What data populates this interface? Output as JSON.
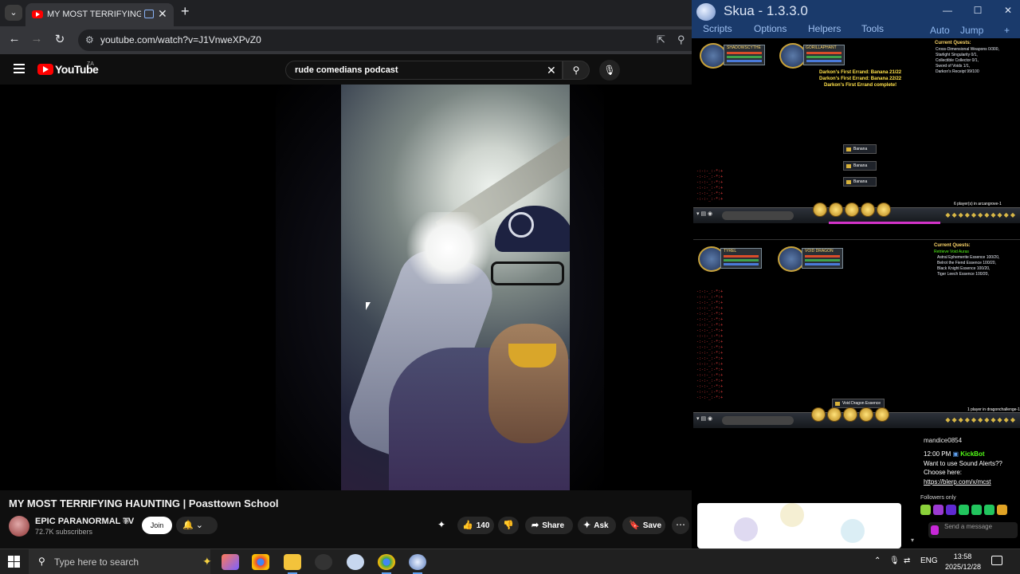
{
  "browser": {
    "tab_menu": "⌄",
    "tab_title": "MY MOST TERRIFYING HAU",
    "tab_close": "✕",
    "new_tab": "+",
    "url": "youtube.com/watch?v=J1VnweXPvZ0"
  },
  "youtube": {
    "logo_text": "YouTube",
    "country": "ZA",
    "search_value": "rude comedians podcast",
    "video_title": "MY MOST TERRIFYING HAUNTING | Poasttown School",
    "channel_name": "EPIC PARANORMAL TV",
    "subscribers": "72.7K subscribers",
    "join_label": "Join",
    "like_count": "140",
    "share_label": "Share",
    "ask_label": "Ask",
    "save_label": "Save"
  },
  "skua": {
    "title": "Skua - 1.3.3.0",
    "menu": [
      "Scripts",
      "Options",
      "Helpers",
      "Tools"
    ],
    "right_menu": [
      "Auto",
      "Jump"
    ],
    "client1": {
      "quest_header": "Current Quests:",
      "quests": [
        "Cross-Dimensional Weapons 0/300,",
        "Starlight Singularity 0/1,",
        "Collectible Collector 0/1,",
        "Sword of Voids 1/1,",
        "Darkon's Receipt 99/100"
      ],
      "messages": [
        "Darkon's First Errand: Banana 21/22",
        "Darkon's First Errand: Banana 22/22",
        "Darkon's First Errand complete!"
      ],
      "drops": [
        "Banana",
        "Banana",
        "Banana"
      ],
      "player_name": "SHADOWSCYTHE",
      "enemy_name": "GORILLAPHANT",
      "players_line": "6 player(s) in arcangrove-1"
    },
    "client2": {
      "quest_header": "Current Quests:",
      "quests": [
        "Retrieve Void Auras",
        "Astral Ephemerite Essence 100/20,",
        "Belrot the Fiend Essence 100/20,",
        "Black Knight Essence 100/20,",
        "Tiger Leech Essence 100/20,"
      ],
      "drop": "Void Dragon Essence",
      "player_name": "TYREL",
      "enemy_name": "VOID DRAGON",
      "players_line": "1 player in dragonchallenge-1"
    }
  },
  "stream_chat": {
    "user": "mandice0854",
    "time": "12:00 PM",
    "bot_name": "KickBot",
    "line1": "Want to use Sound Alerts??",
    "line2": "Choose here:",
    "link": "https://blerp.com/x/mcst",
    "followers_only": "Followers only",
    "send_placeholder": "Send a message"
  },
  "taskbar": {
    "search_placeholder": "Type here to search",
    "language": "ENG",
    "time": "13:58",
    "date": "2025/12/28"
  }
}
